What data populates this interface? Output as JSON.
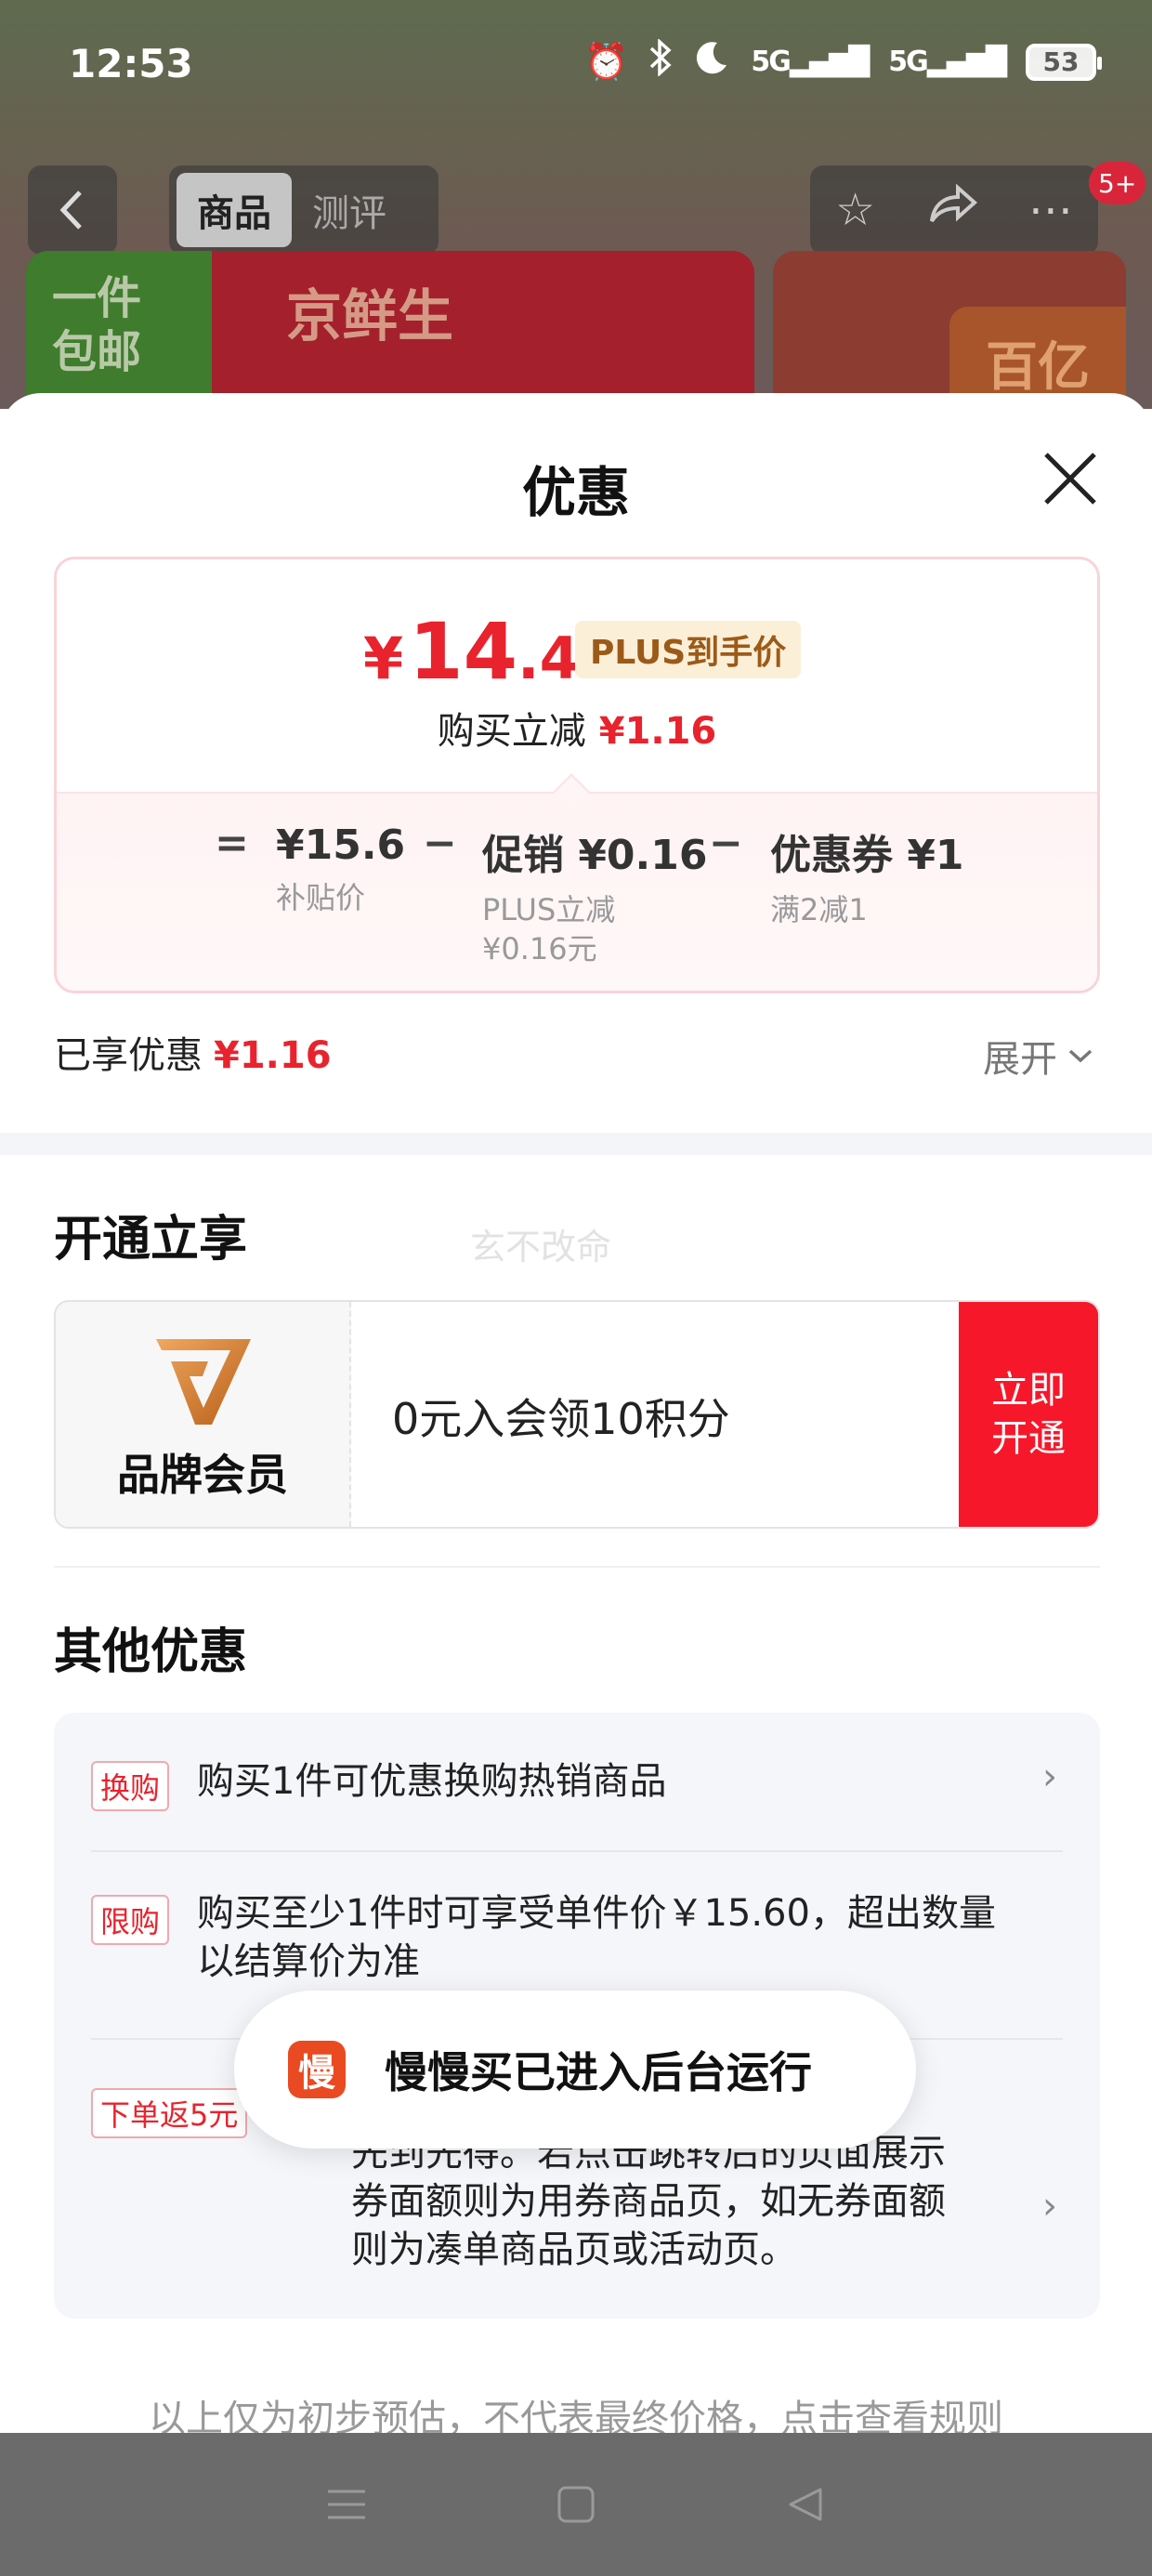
{
  "status_bar": {
    "time": "12:53",
    "signal1": "5G",
    "signal2": "5G",
    "battery": "53",
    "icons": [
      "alarm-icon",
      "bluetooth-icon",
      "moon-icon",
      "signal-icon",
      "battery-icon"
    ]
  },
  "product_nav": {
    "tabs": [
      "商品",
      "测评"
    ],
    "active_tab": "商品",
    "badge": "5+"
  },
  "banner": {
    "left_tag": "一件\n包邮",
    "left_title": "京鲜生",
    "right_text": "百亿"
  },
  "sheet": {
    "title": "优惠",
    "price": {
      "yen": "¥",
      "integer": "14",
      "decimal": ".44",
      "plus_tag": "PLUS到手价",
      "buy_reduce_label": "购买立减",
      "buy_reduce_amount": "¥1.16"
    },
    "calc": {
      "op_eq": "=",
      "base_price": "¥15.6",
      "base_label": "补贴价",
      "op_minus1": "−",
      "promo_main": "促销 ¥0.16",
      "promo_sub1": "PLUS立减",
      "promo_sub2": "¥0.16元",
      "op_minus2": "−",
      "coupon_main": "优惠券 ¥1",
      "coupon_sub": "满2减1"
    },
    "enjoyed_label": "已享优惠",
    "enjoyed_amount": "¥1.16",
    "expand_label": "展开",
    "open_section_title": "开通立享",
    "watermark": "玄不改命",
    "member": {
      "name": "品牌会员",
      "offer": "0元入会领10积分",
      "button": "立即\n开通"
    },
    "other_section_title": "其他优惠",
    "other_items": [
      {
        "tag": "换购",
        "text": "购买1件可优惠换购热销商品"
      },
      {
        "tag": "限购",
        "text": "购买至少1件时可享受单件价￥15.60，超出数量以结算价为准"
      },
      {
        "tag": "下单返5元",
        "text_line1": "先到先得。若点击跳转后的页面展示",
        "text_line2": "券面额则为用券商品页，如无券面额",
        "text_line3": "则为凑单商品页或活动页。"
      }
    ],
    "disclaimer": "以上仅为初步预估，不代表最终价格，点击查看规则"
  },
  "toast": {
    "icon_char": "慢",
    "text": "慢慢买已进入后台运行"
  },
  "colors": {
    "accent_red": "#e8232e",
    "button_red": "#f7172b",
    "plus_gold": "#9c5a18"
  }
}
